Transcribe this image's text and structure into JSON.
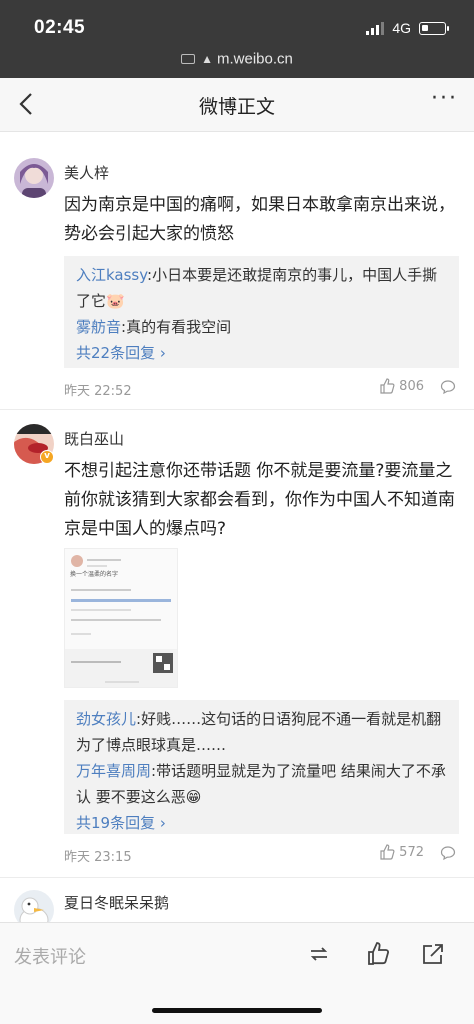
{
  "status": {
    "time": "02:45",
    "network": "4G"
  },
  "browser": {
    "url": "m.weibo.cn"
  },
  "nav": {
    "title": "微博正文"
  },
  "comments": [
    {
      "user": "美人梓",
      "text": "因为南京是中国的痛啊，如果日本敢拿南京出来说，势必会引起大家的愤怒",
      "replies": [
        {
          "name": "入江kassy",
          "text": ":小日本要是还敢提南京的事儿，中国人手撕了它🐷"
        },
        {
          "name": "雾舫音",
          "text": ":真的有看我空间"
        }
      ],
      "reply_count": "共22条回复",
      "time": "昨天 22:52",
      "likes": "806"
    },
    {
      "user": "既白巫山",
      "text": "不想引起注意你还带话题 你不就是要流量?要流量之前你就该猜到大家都会看到，你作为中国人不知道南京是中国人的爆点吗?",
      "image_caption": "换一个温柔的名字",
      "replies": [
        {
          "name": "劲女孩儿",
          "text": ":好贱……这句话的日语狗屁不通一看就是机翻 为了博点眼球真是……"
        },
        {
          "name": "万年喜周周",
          "text": ":带话题明显就是为了流量吧 结果闹大了不承认 要不要这么恶😁"
        }
      ],
      "reply_count": "共19条回复",
      "time": "昨天 23:15",
      "likes": "572"
    },
    {
      "user": "夏日冬眠呆呆鹅"
    }
  ],
  "bottom": {
    "compose_placeholder": "发表评论"
  },
  "colors": {
    "link": "#4d7ebf",
    "topbar": "#3a3a3a"
  }
}
